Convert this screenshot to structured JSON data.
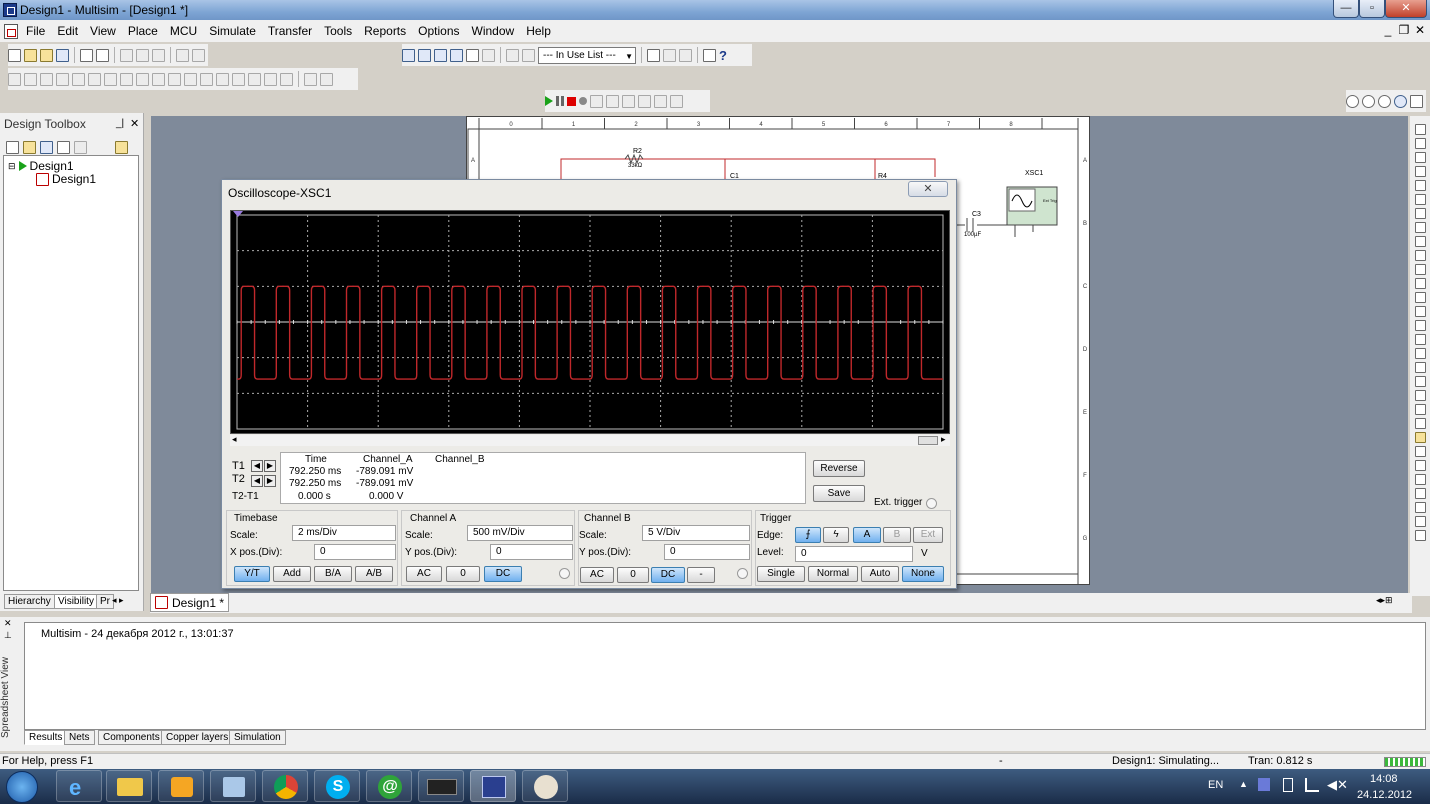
{
  "window": {
    "title": "Design1 - Multisim - [Design1 *]"
  },
  "menu": [
    "File",
    "Edit",
    "View",
    "Place",
    "MCU",
    "Simulate",
    "Transfer",
    "Tools",
    "Reports",
    "Options",
    "Window",
    "Help"
  ],
  "toolbar": {
    "in_use_list": "--- In Use List ---"
  },
  "design_toolbox": {
    "title": "Design Toolbox",
    "root": "Design1",
    "child": "Design1",
    "tabs": [
      "Hierarchy",
      "Visibility",
      "Pr"
    ]
  },
  "doc_tab": "Design1 *",
  "schematic": {
    "col_labels": [
      "0",
      "1",
      "2",
      "3",
      "4",
      "5",
      "6",
      "7",
      "8"
    ],
    "row_labels": [
      "A",
      "B",
      "C",
      "D",
      "E",
      "F",
      "G"
    ],
    "r2_name": "R2",
    "r2_value": "33kΩ",
    "c1_name": "C1",
    "r4_name": "R4",
    "c3_name": "C3",
    "c3_value": "100µF",
    "xsc1_name": "XSC1",
    "xsc_ext_label": "Ext Trig"
  },
  "scope": {
    "title": "Oscilloscope-XSC1",
    "close": "✕",
    "readout": {
      "headers": {
        "time": "Time",
        "a": "Channel_A",
        "b": "Channel_B"
      },
      "t1": {
        "label": "T1",
        "time": "792.250 ms",
        "a": "-789.091 mV"
      },
      "t2": {
        "label": "T2",
        "time": "792.250 ms",
        "a": "-789.091 mV"
      },
      "diff": {
        "label": "T2-T1",
        "time": "0.000 s",
        "a": "0.000 V"
      }
    },
    "reverse": "Reverse",
    "save": "Save",
    "ext_trigger": "Ext. trigger",
    "timebase": {
      "title": "Timebase",
      "scale_label": "Scale:",
      "scale": "2 ms/Div",
      "xpos_label": "X pos.(Div):",
      "xpos": "0",
      "buttons": [
        "Y/T",
        "Add",
        "B/A",
        "A/B"
      ]
    },
    "channel_a": {
      "title": "Channel A",
      "scale_label": "Scale:",
      "scale": "500 mV/Div",
      "ypos_label": "Y pos.(Div):",
      "ypos": "0",
      "buttons": [
        "AC",
        "0",
        "DC"
      ]
    },
    "channel_b": {
      "title": "Channel B",
      "scale_label": "Scale:",
      "scale": "5  V/Div",
      "ypos_label": "Y pos.(Div):",
      "ypos": "0",
      "buttons": [
        "AC",
        "0",
        "DC",
        "-"
      ]
    },
    "trigger": {
      "title": "Trigger",
      "edge_label": "Edge:",
      "edge_buttons": [
        "A",
        "B",
        "Ext"
      ],
      "level_label": "Level:",
      "level": "0",
      "level_unit": "V",
      "buttons": [
        "Single",
        "Normal",
        "Auto",
        "None"
      ]
    },
    "waveform": {
      "cycles": 20,
      "color": "#c0282b",
      "high_div": -1,
      "low_div": 1.6
    }
  },
  "spreadsheet": {
    "label": "Spreadsheet View",
    "log": "Multisim  -  24 декабря 2012 г., 13:01:37",
    "tabs": [
      "Results",
      "Nets",
      "Components",
      "Copper layers",
      "Simulation"
    ]
  },
  "status": {
    "help": "For Help, press F1",
    "dash": "-",
    "sim": "Design1: Simulating...",
    "tran": "Tran: 0.812 s"
  },
  "taskbar": {
    "lang": "EN",
    "time": "14:08",
    "date": "24.12.2012"
  }
}
